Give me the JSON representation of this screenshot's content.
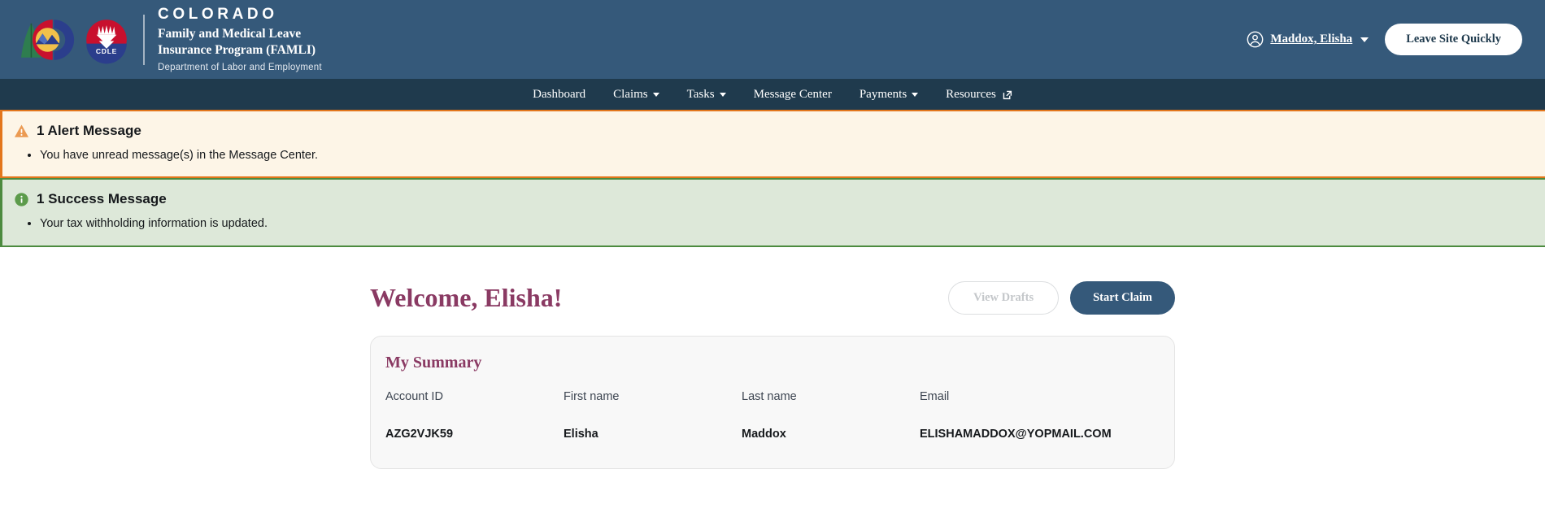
{
  "masthead": {
    "logo_co_name": "colorado-state-logo",
    "logo_cdle_name": "cdle-seal-logo",
    "brand_colorado": "COLORADO",
    "brand_program_line1": "Family and Medical Leave",
    "brand_program_line2": "Insurance Program (FAMLI)",
    "brand_department": "Department of Labor and Employment",
    "user_name": "Maddox, Elisha",
    "leave_site_label": "Leave Site Quickly",
    "bg_color": "#35597a"
  },
  "nav": {
    "bg_color": "#1f3a4d",
    "items": [
      {
        "label": "Dashboard",
        "has_caret": false,
        "external": false
      },
      {
        "label": "Claims",
        "has_caret": true,
        "external": false
      },
      {
        "label": "Tasks",
        "has_caret": true,
        "external": false
      },
      {
        "label": "Message Center",
        "has_caret": false,
        "external": false
      },
      {
        "label": "Payments",
        "has_caret": true,
        "external": false
      },
      {
        "label": "Resources",
        "has_caret": false,
        "external": true
      }
    ]
  },
  "alerts": [
    {
      "type": "alert",
      "icon": "warning-triangle-icon",
      "title": "1 Alert Message",
      "messages": [
        "You have unread message(s) in the Message Center."
      ],
      "accent_color": "#e3761c",
      "bg_color": "#fdf5e7"
    },
    {
      "type": "success",
      "icon": "info-circle-icon",
      "title": "1 Success Message",
      "messages": [
        "Your tax withholding information is updated."
      ],
      "accent_color": "#4c8b3f",
      "bg_color": "#dde8d9"
    }
  ],
  "main": {
    "welcome_title": "Welcome, Elisha!",
    "view_drafts_label": "View Drafts",
    "start_claim_label": "Start Claim",
    "accent_color": "#8a3a63",
    "summary": {
      "title": "My Summary",
      "headers": [
        "Account ID",
        "First name",
        "Last name",
        "Email"
      ],
      "values": [
        "AZG2VJK59",
        "Elisha",
        "Maddox",
        "ELISHAMADDOX@YOPMAIL.COM"
      ]
    }
  }
}
